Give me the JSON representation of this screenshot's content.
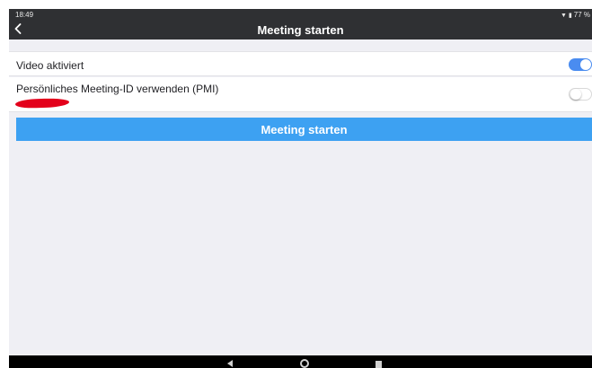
{
  "status_bar": {
    "time": "18:49",
    "battery": "77 %",
    "icons": [
      "wifi-icon",
      "battery-icon"
    ]
  },
  "header": {
    "title": "Meeting starten",
    "back_icon": "chevron-left-icon"
  },
  "settings": [
    {
      "label": "Video aktiviert",
      "enabled": true
    },
    {
      "label": "Persönliches Meeting-ID verwenden (PMI)",
      "enabled": false
    }
  ],
  "start_button": {
    "label": "Meeting starten"
  },
  "colors": {
    "header_bg": "#2f3033",
    "accent": "#3da1f2",
    "toggle_on": "#4a8cf0",
    "background": "#efeff4",
    "redaction": "#e3001b"
  },
  "nav_bar": {
    "icons": [
      "back-icon",
      "home-icon",
      "recents-icon"
    ]
  }
}
